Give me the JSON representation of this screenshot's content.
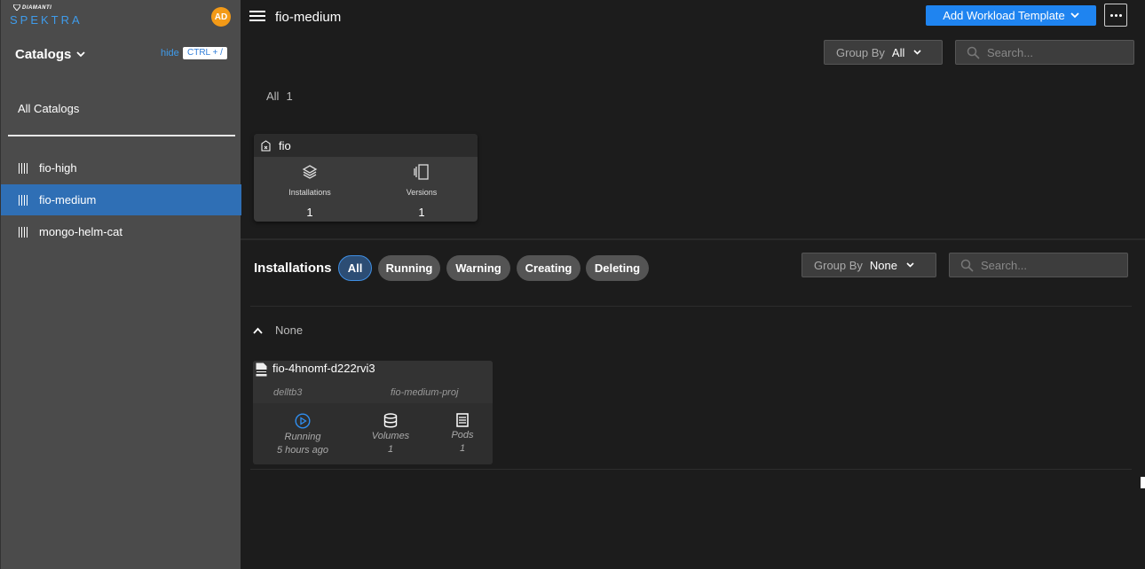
{
  "brand": {
    "company": "DIAMANTI",
    "product": "SPEKTRA"
  },
  "user": {
    "initials": "AD"
  },
  "sidebar": {
    "title": "Catalogs",
    "hide_label": "hide",
    "shortcut": "CTRL + /",
    "all_label": "All Catalogs",
    "items": [
      {
        "label": "fio-high"
      },
      {
        "label": "fio-medium"
      },
      {
        "label": "mongo-helm-cat"
      }
    ]
  },
  "header": {
    "title": "fio-medium",
    "add_button": "Add Workload Template"
  },
  "catalog_filters": {
    "group_by_label": "Group By",
    "group_by_value": "All",
    "search_placeholder": "Search..."
  },
  "summary": {
    "label": "All",
    "count": "1"
  },
  "catalog_card": {
    "name": "fio",
    "installations_label": "Installations",
    "installations_count": "1",
    "versions_label": "Versions",
    "versions_count": "1"
  },
  "installations": {
    "title": "Installations",
    "filters": [
      "All",
      "Running",
      "Warning",
      "Creating",
      "Deleting"
    ],
    "group_by_label": "Group By",
    "group_by_value": "None",
    "search_placeholder": "Search...",
    "group_name": "None",
    "card": {
      "name": "fio-4hnomf-d222rvi3",
      "cluster": "delltb3",
      "project": "fio-medium-proj",
      "status": "Running",
      "status_time": "5 hours ago",
      "volumes_label": "Volumes",
      "volumes_count": "1",
      "pods_label": "Pods",
      "pods_count": "1"
    }
  },
  "colors": {
    "accent": "#1f84f0",
    "sidebar_active": "#2f6fb5",
    "avatar": "#f39a17"
  }
}
